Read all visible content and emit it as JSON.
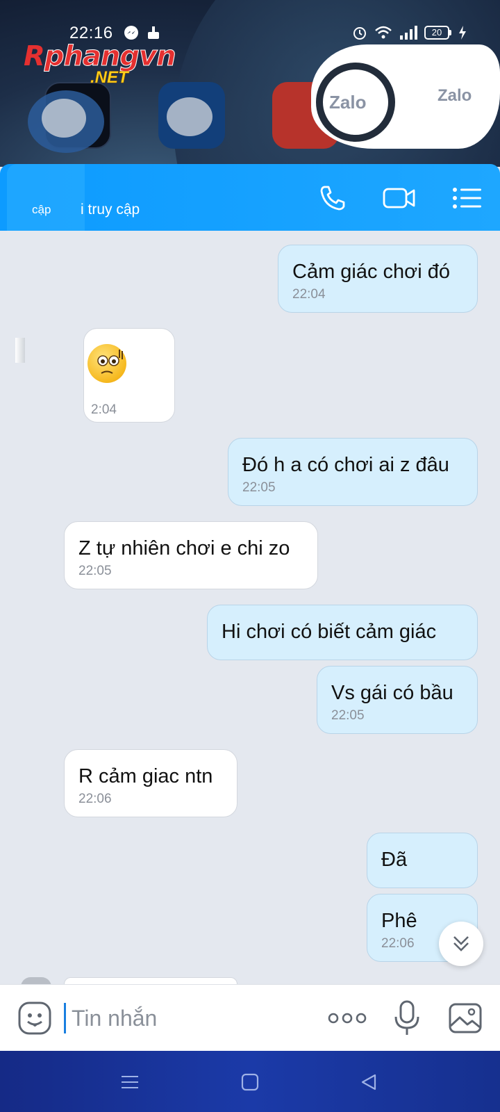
{
  "status_bar": {
    "time": "22:16",
    "battery": "20"
  },
  "watermark": {
    "brand": "Rphangvn",
    "domain": ".NET"
  },
  "home_screen": {
    "zalo_labels": [
      "Zalo",
      "Zalo"
    ]
  },
  "header": {
    "status_left": "cập",
    "status_right": "i truy cập"
  },
  "messages": [
    {
      "side": "sent",
      "text": "Cảm giác chơi đó",
      "time": "22:04"
    },
    {
      "side": "recv",
      "text": "",
      "time": "2:04"
    },
    {
      "side": "sent",
      "text": "Đó h a có chơi ai z đâu",
      "time": "22:05"
    },
    {
      "side": "recv",
      "text": "Z tự nhiên chơi e chi zo",
      "time": "22:05"
    },
    {
      "side": "sent",
      "text": "Hi chơi có biết cảm giác",
      "time": ""
    },
    {
      "side": "sent",
      "text": "Vs gái có bầu",
      "time": "22:05"
    },
    {
      "side": "recv",
      "text": "R cảm giac ntn",
      "time": "22:06"
    },
    {
      "side": "sent",
      "text": "Đã",
      "time": ""
    },
    {
      "side": "sent",
      "text": "Phê",
      "time": "22:06"
    }
  ],
  "input": {
    "placeholder": "Tin nhắn"
  },
  "colors": {
    "header": "#1ea7ff",
    "sent_bubble": "#d6effd",
    "recv_bubble": "#ffffff",
    "chat_bg": "#e4e8ef",
    "nav_bar": "#1b3aa8"
  }
}
